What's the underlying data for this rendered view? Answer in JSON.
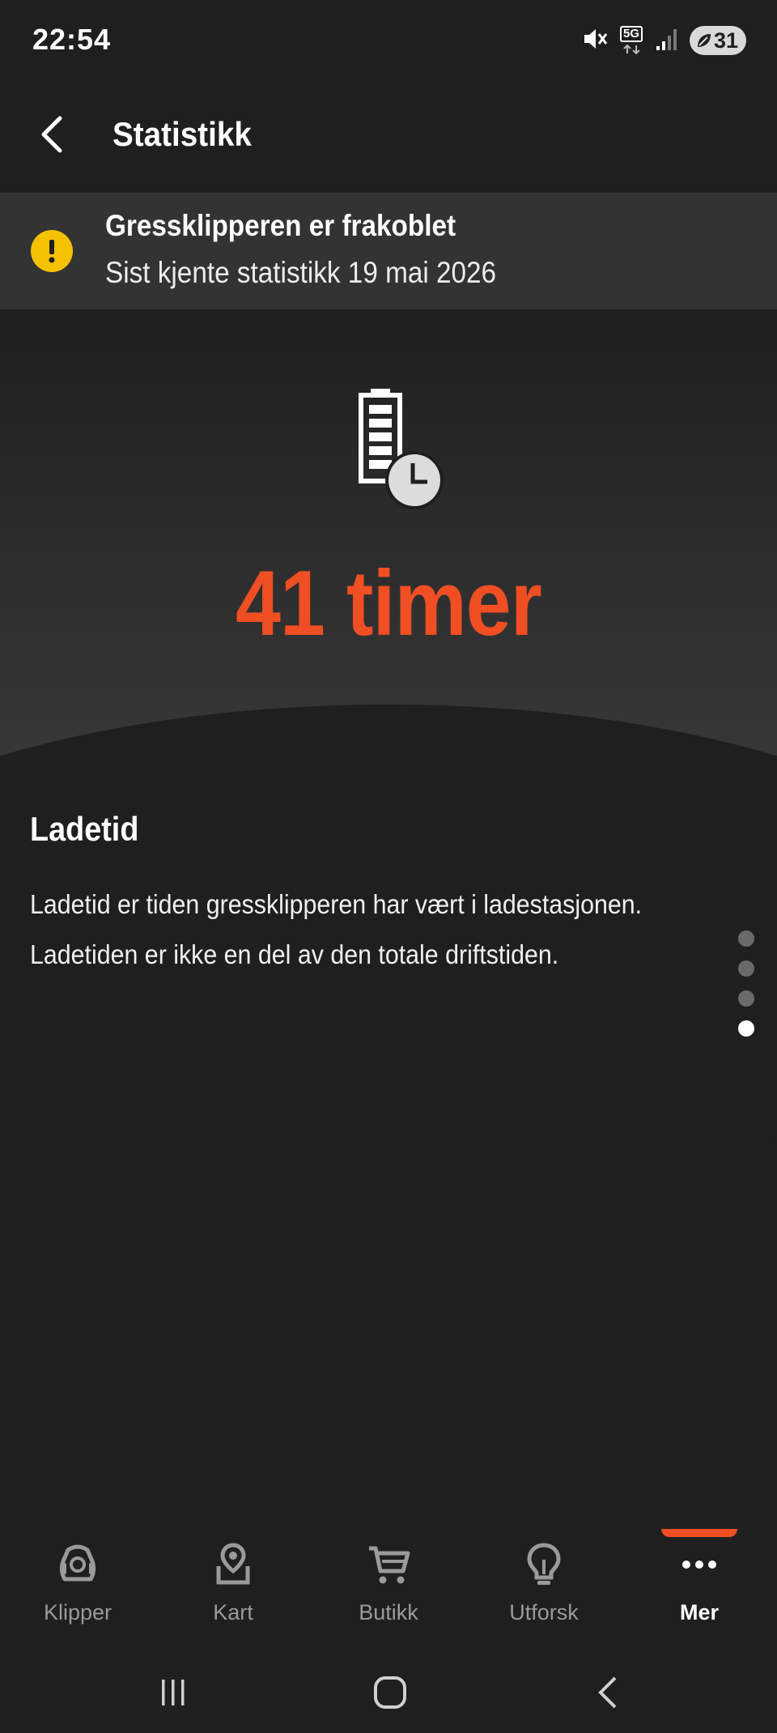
{
  "status_bar": {
    "time": "22:54",
    "network": "5G",
    "battery": "31"
  },
  "header": {
    "title": "Statistikk"
  },
  "banner": {
    "title": "Gressklipperen er frakoblet",
    "subtitle": "Sist kjente statistikk 19 mai 2026",
    "icon": "warning-icon",
    "icon_color": "#f5c200"
  },
  "hero": {
    "icon": "battery-clock-icon",
    "value": "41 timer",
    "value_color": "#f04e23"
  },
  "info": {
    "title": "Ladetid",
    "text": "Ladetid er tiden gressklipperen har vært i ladestasjonen. Ladetiden er ikke en del av den totale driftstiden."
  },
  "pager": {
    "count": 4,
    "active_index": 3
  },
  "bottom_nav": {
    "items": [
      {
        "label": "Klipper",
        "icon": "mower-icon",
        "active": false
      },
      {
        "label": "Kart",
        "icon": "map-pin-icon",
        "active": false
      },
      {
        "label": "Butikk",
        "icon": "cart-icon",
        "active": false
      },
      {
        "label": "Utforsk",
        "icon": "lightbulb-icon",
        "active": false
      },
      {
        "label": "Mer",
        "icon": "more-icon",
        "active": true
      }
    ],
    "accent": "#f04e23"
  }
}
